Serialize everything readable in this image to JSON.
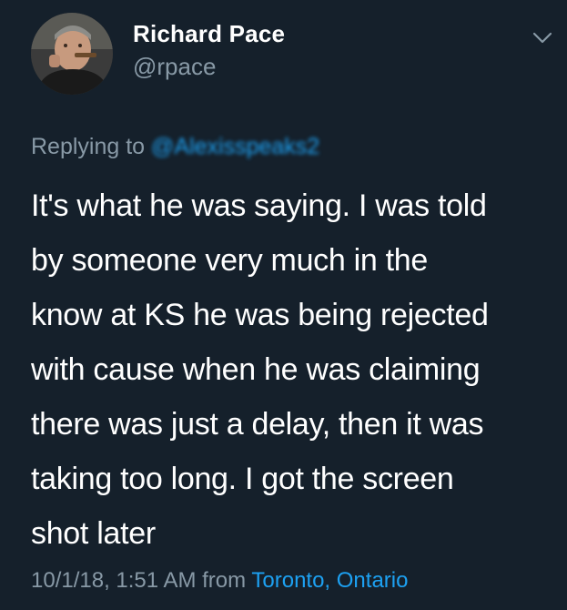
{
  "tweet": {
    "display_name": "Richard Pace",
    "handle": "@rpace",
    "replying_prefix": "Replying to",
    "replying_to": "@Alexisspeaks2",
    "text": "It's what he was saying.  I was told\nby someone very much in the\nknow at KS he was being rejected\nwith cause when he was claiming\nthere was just a delay, then it was\ntaking too long.  I got the screen\nshot later",
    "timestamp": "10/1/18, 1:51 AM",
    "from_label": "from",
    "location": "Toronto, Ontario"
  },
  "icons": {
    "menu": "chevron-down-icon"
  },
  "colors": {
    "background": "#15202b",
    "text": "#ffffff",
    "secondary": "#8899a6",
    "accent": "#1da1f2"
  }
}
